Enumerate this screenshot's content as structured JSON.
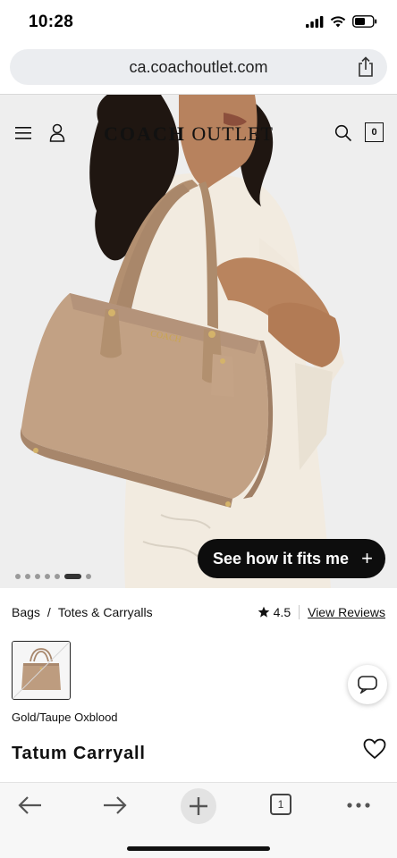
{
  "status": {
    "time": "10:28"
  },
  "browser": {
    "url": "ca.coachoutlet.com",
    "tabs_count": "1"
  },
  "site": {
    "logo_brand": "COACH",
    "logo_suffix": "OUTLET",
    "bag_count": "0"
  },
  "hero": {
    "fit_button_label": "See how it fits me",
    "fit_button_plus": "+",
    "dots_total": 7,
    "dot_active_index": 5
  },
  "breadcrumb": {
    "level1": "Bags",
    "separator": "/",
    "level2": "Totes & Carryalls"
  },
  "rating": {
    "value": "4.5",
    "reviews_link": "View Reviews"
  },
  "product": {
    "color_name": "Gold/Taupe Oxblood",
    "title": "Tatum Carryall"
  },
  "colors": {
    "bag_taupe": "#b99a7d",
    "button_black": "#0d0d0d",
    "toolbar_bg": "#f7f7f7"
  },
  "icons": [
    "share-icon",
    "menu-icon",
    "account-icon",
    "search-icon",
    "bag-icon",
    "star-icon",
    "chat-icon",
    "heart-icon",
    "back-icon",
    "forward-icon",
    "plus-icon",
    "tabs-icon",
    "more-icon"
  ]
}
